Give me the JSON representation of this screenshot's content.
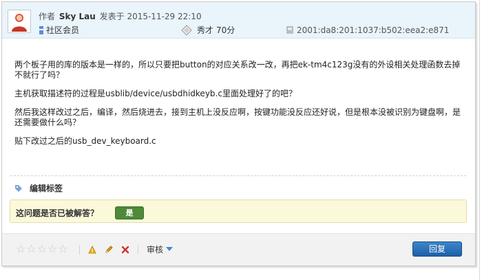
{
  "header": {
    "author_prefix": "作者",
    "author": "Sky Lau",
    "posted_prefix": "发表于",
    "date": "2015-11-29 22:10",
    "rank": "社区会员",
    "reputation_label": "秀才",
    "reputation_points": "70分",
    "ip": "2001:da8:201:1037:b502:eea2:e871"
  },
  "body": {
    "paragraphs": [
      "两个板子用的库的版本是一样的，所以只要把button的对应关系改一改，再把ek-tm4c123g没有的外设相关处理函数去掉不就行了吗？",
      "主机获取描述符的过程是usblib/device/usbdhidkeyb.c里面处理好了的吧？",
      "然后我这样改过之后，编译，然后烧进去，接到主机上没反应啊，按键功能没反应还好说，但是根本没被识别为键盘啊，是还需要做什么吗？",
      "贴下改过之后的usb_dev_keyboard.c"
    ]
  },
  "tags": {
    "edit_label": "编辑标签"
  },
  "answered": {
    "question": "这问题是否已被解答？",
    "yes": "是"
  },
  "footer": {
    "review_label": "审核",
    "reply_label": "回复"
  },
  "icons": [
    "user-avatar-icon",
    "rank-icon",
    "reputation-badge-icon",
    "ip-icon",
    "tag-icon",
    "star-icon",
    "warning-icon",
    "edit-pencil-icon",
    "delete-icon",
    "chevron-down-icon"
  ],
  "colors": {
    "header_bg": "#e9f4fb",
    "answered_bg": "#fcf9da",
    "yes_button": "#4e8a38",
    "reply_button": "#2a6fb6"
  }
}
